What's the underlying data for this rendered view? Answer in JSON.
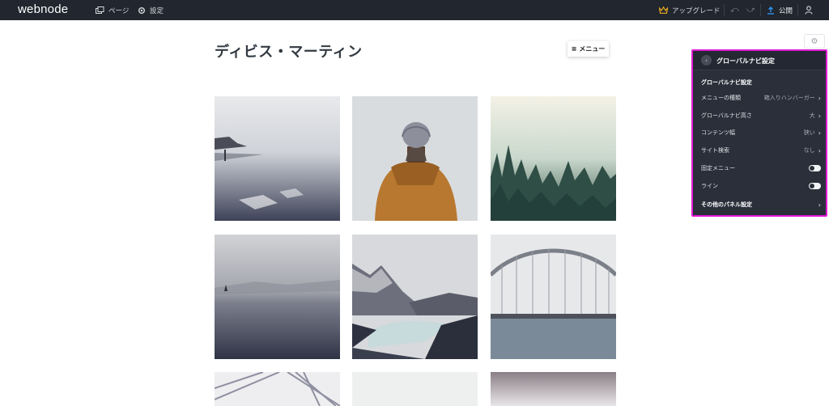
{
  "topbar": {
    "logo": "webnode",
    "pages_label": "ページ",
    "settings_label": "設定",
    "upgrade_label": "アップグレード",
    "publish_label": "公開"
  },
  "page": {
    "title": "ディビス・マーティン",
    "menu_label": "メニュー"
  },
  "gallery": {
    "tiles": [
      "coast-fog",
      "hiker-beanie",
      "misty-forest",
      "sea-sailboat",
      "mountain-lake",
      "bridge-arch",
      "bridge-cables",
      "pale-sky",
      "dusk-plain"
    ]
  },
  "panel": {
    "header_title": "グローバルナビ設定",
    "section_title": "グローバルナビ設定",
    "rows": [
      {
        "label": "メニューの種類",
        "value": "箱入りハンバーガー"
      },
      {
        "label": "グローバルナビ高さ",
        "value": "大"
      },
      {
        "label": "コンテンツ幅",
        "value": "狭い"
      },
      {
        "label": "サイト検索",
        "value": "なし"
      },
      {
        "label": "固定メニュー",
        "value": "on"
      },
      {
        "label": "ライン",
        "value": "on"
      },
      {
        "label": "その他のパネル設定",
        "value": ""
      }
    ]
  },
  "colors": {
    "topbar_bg": "#21262f",
    "panel_bg": "#2a2f3a",
    "highlight_border": "#e21ad6",
    "crown": "#f2b01e",
    "publish_arrow": "#2f9bff"
  }
}
